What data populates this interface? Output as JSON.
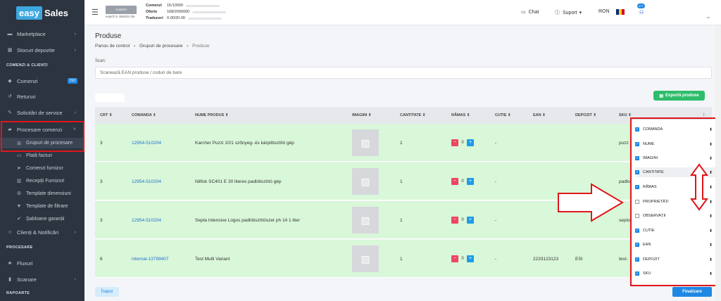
{
  "brand": {
    "part1": "easy",
    "part2": "Sales"
  },
  "sidebar": {
    "items": [
      {
        "label": "Marketplace",
        "icon": "store-icon",
        "chev": true
      },
      {
        "label": "Stocuri depozite",
        "icon": "boxes-icon",
        "chev": true
      }
    ],
    "section1": "COMENZI & CLIENȚI",
    "items2": [
      {
        "label": "Comenzi",
        "icon": "tag-icon",
        "badge": "293"
      },
      {
        "label": "Retururi",
        "icon": "undo-icon"
      },
      {
        "label": "Solicitări de service",
        "icon": "wrench-icon",
        "chev": true
      },
      {
        "label": "Procesare comenzi",
        "icon": "truck-icon",
        "chev": true
      }
    ],
    "subitems": [
      {
        "label": "Grupuri de procesare",
        "icon": "sitemap-icon"
      },
      {
        "label": "Plată facturi",
        "icon": "money-icon"
      },
      {
        "label": "Comenzi furnizor",
        "icon": "send-icon"
      },
      {
        "label": "Recepții Furnizori",
        "icon": "warehouse-icon"
      },
      {
        "label": "Template dimensiuni",
        "icon": "ruler-icon"
      },
      {
        "label": "Template de filtrare",
        "icon": "filter-icon"
      },
      {
        "label": "Șabloane garanții",
        "icon": "check-circle-icon"
      }
    ],
    "items3": [
      {
        "label": "Clienți & Notificări",
        "icon": "users-icon",
        "chev": true
      }
    ],
    "section2": "PROCESARE",
    "items4": [
      {
        "label": "Fluxuri",
        "icon": "flow-icon"
      },
      {
        "label": "Scanare",
        "icon": "barcode-icon",
        "chev": true
      }
    ],
    "section3": "RAPOARTE"
  },
  "topbar": {
    "custom_label": "Custom",
    "expira": "expiră în 356003 zile",
    "stats": [
      {
        "label": "Comenzi",
        "value": "15/10000"
      },
      {
        "label": "Oferte",
        "value": "168/2000000"
      },
      {
        "label": "Traduceri",
        "value": "0.00/20.00"
      }
    ],
    "chat": "Chat",
    "support": "Suport",
    "currency": "RON",
    "bell_count": "477",
    "avatar_note": "zo"
  },
  "page": {
    "title": "Produse",
    "breadcrumb": [
      "Panou de control",
      "Grupuri de procesare",
      "Produse"
    ],
    "scan_label": "Scan:",
    "scan_placeholder": "Scanează EAN produse / coduri de bare",
    "export_label": "Exportă produse",
    "back_label": "Înapoi",
    "finish_label": "Finalizare"
  },
  "table": {
    "headers": [
      "CRT",
      "COMANDA",
      "NUME PRODUS",
      "IMAGINI",
      "CANTITATE",
      "RĂMAS",
      "CUTIE",
      "EAN",
      "DEPOZIT",
      "SKU"
    ],
    "rows": [
      {
        "crt": "3",
        "comanda": "12954-510204",
        "nume": "Karcher Puzzi 10/1 szőnyeg- és kárpittisztító gép",
        "cantitate": "1",
        "ramas": "0",
        "cutie": "-",
        "ean": "",
        "depozit": "",
        "sku": "puzz"
      },
      {
        "crt": "3",
        "comanda": "12954-510204",
        "nume": "Nilfisk SC401 E 30 literes padlótisztító gép",
        "cantitate": "1",
        "ramas": "0",
        "cutie": "-",
        "ean": "",
        "depozit": "",
        "sku": "padlo"
      },
      {
        "crt": "3",
        "comanda": "12954-510204",
        "nume": "Septa Intensive Lúgos padlótisztítószer ph 14 1 liter",
        "cantitate": "1",
        "ramas": "0",
        "cutie": "-",
        "ean": "",
        "depozit": "",
        "sku": "septo"
      },
      {
        "crt": "6",
        "comanda": "internal-13799407",
        "nume": "Test Multi Variant",
        "cantitate": "1",
        "ramas": "0",
        "cutie": "-",
        "ean": "2233123123",
        "depozit": "ESI",
        "sku": "test-"
      }
    ]
  },
  "column_panel": {
    "options": [
      {
        "label": "COMANDA",
        "checked": true
      },
      {
        "label": "NUME",
        "checked": true
      },
      {
        "label": "IMAGINI",
        "checked": true
      },
      {
        "label": "CANTITATE",
        "checked": true
      },
      {
        "label": "RĂMAS",
        "checked": true
      },
      {
        "label": "PROPRIETĂȚI",
        "checked": false
      },
      {
        "label": "OBSERVAȚII",
        "checked": false
      },
      {
        "label": "CUTIE",
        "checked": true
      },
      {
        "label": "EAN",
        "checked": true
      },
      {
        "label": "DEPOZIT",
        "checked": true
      },
      {
        "label": "SKU",
        "checked": true
      }
    ]
  },
  "colors": {
    "accent": "#1e88e5",
    "sidebar": "#2c3440",
    "row_bg": "#d9f7d9",
    "highlight": "#e0161b",
    "export": "#2ebd6b"
  }
}
